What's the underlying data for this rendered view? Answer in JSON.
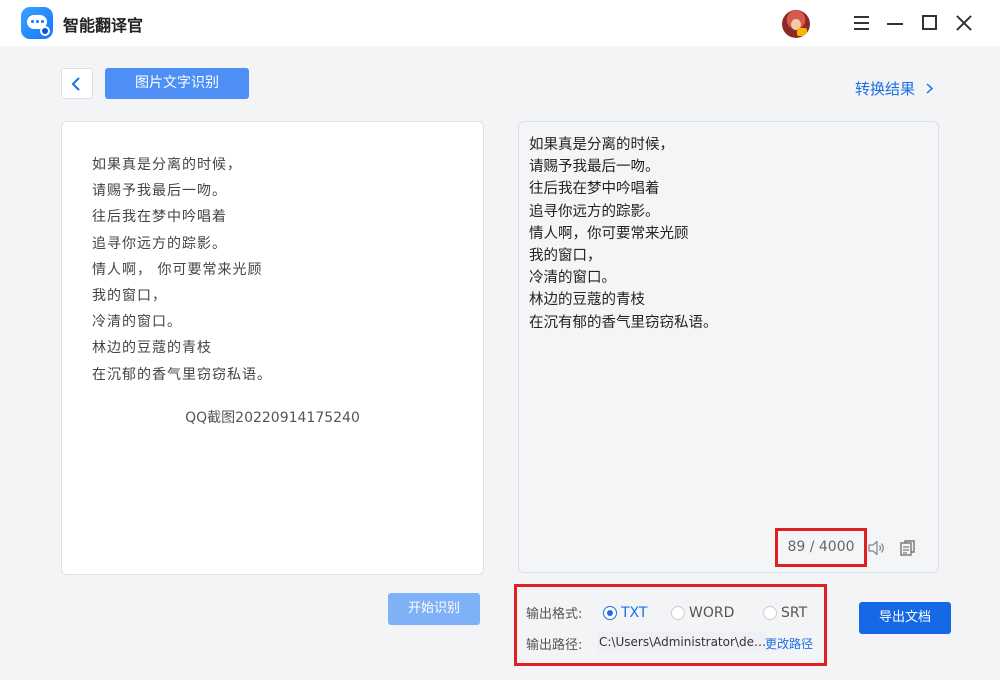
{
  "app": {
    "title": "智能翻译官"
  },
  "header": {
    "page_title": "图片文字识别",
    "result_link": "转换结果"
  },
  "source_image": {
    "lines": [
      "如果真是分离的时候，",
      "请赐予我最后一吻。",
      "往后我在梦中吟唱着",
      "追寻你远方的踪影。",
      "情人啊， 你可要常来光顾",
      "我的窗口，",
      "冷清的窗口。",
      "林边的豆蔻的青枝",
      "在沉郁的香气里窃窃私语。"
    ],
    "caption": "QQ截图20220914175240"
  },
  "result": {
    "lines": [
      "如果真是分离的时候，",
      "请赐予我最后一吻。",
      "往后我在梦中吟唱着",
      "追寻你远方的踪影。",
      "情人啊，你可要常来光顾",
      "我的窗口，",
      "冷清的窗口。",
      "林边的豆蔻的青枝",
      "在沉有郁的香气里窃窃私语。"
    ],
    "char_count": "89 / 4000"
  },
  "controls": {
    "start_label": "开始识别",
    "format_label": "输出格式:",
    "formats": [
      {
        "label": "TXT",
        "checked": true
      },
      {
        "label": "WORD",
        "checked": false
      },
      {
        "label": "SRT",
        "checked": false
      }
    ],
    "path_label": "输出路径:",
    "path_value": "C:\\Users\\Administrator\\des...",
    "change_path_label": "更改路径",
    "export_label": "导出文档"
  },
  "colors": {
    "accent": "#1d6fe6",
    "primary_button": "#1568e6",
    "highlight_border": "#e02020"
  },
  "icons": [
    "app-logo",
    "avatar",
    "menu-icon",
    "minimize-icon",
    "maximize-icon",
    "close-icon",
    "back-arrow-icon",
    "chevron-right-icon",
    "speaker-icon",
    "copy-icon"
  ]
}
